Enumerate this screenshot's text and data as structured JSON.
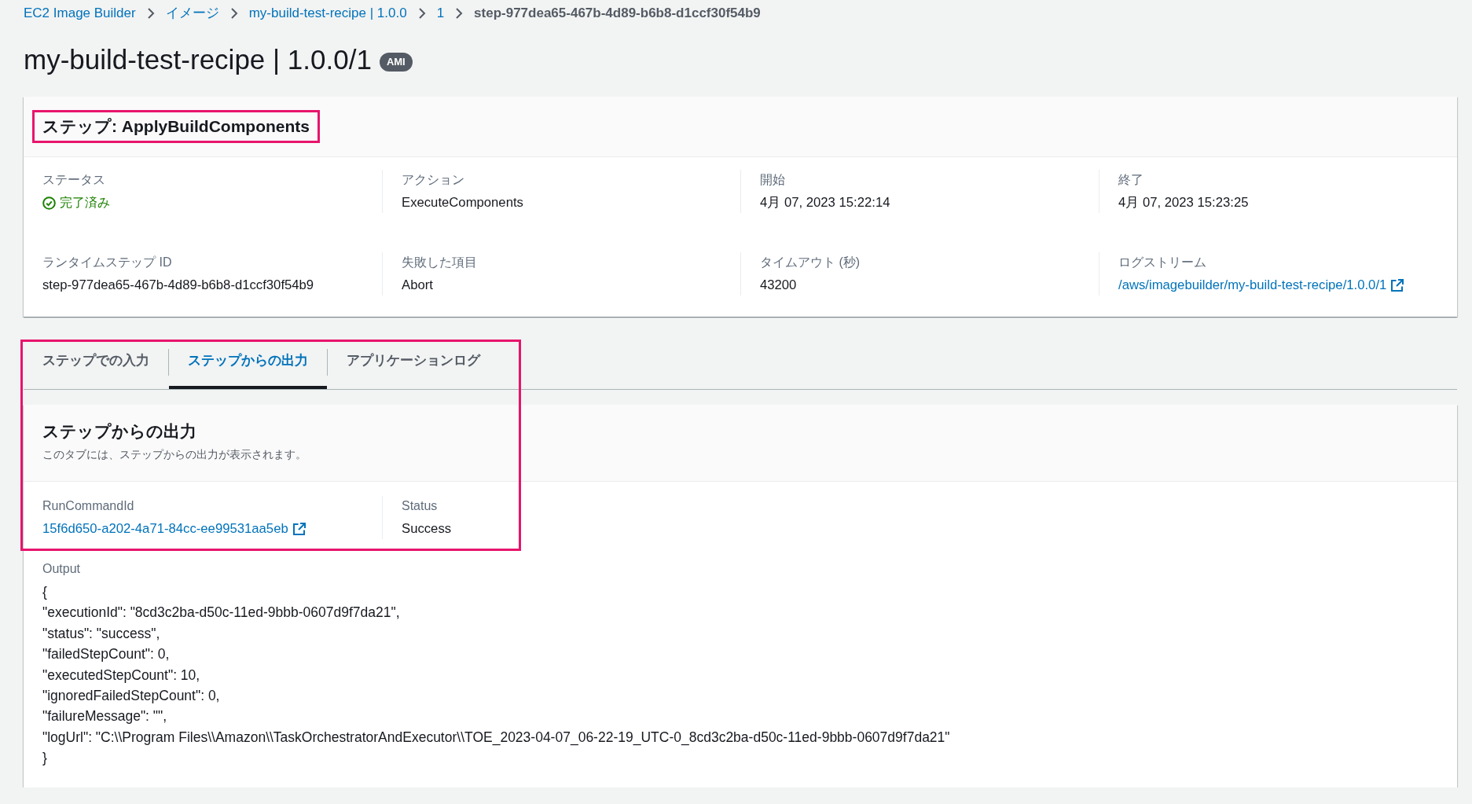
{
  "breadcrumbs": [
    {
      "label": "EC2 Image Builder",
      "current": false
    },
    {
      "label": "イメージ",
      "current": false
    },
    {
      "label": "my-build-test-recipe | 1.0.0",
      "current": false
    },
    {
      "label": "1",
      "current": false
    },
    {
      "label": "step-977dea65-467b-4d89-b6b8-d1ccf30f54b9",
      "current": true
    }
  ],
  "page_title": {
    "text": "my-build-test-recipe | 1.0.0/1",
    "badge": "AMI"
  },
  "step_card": {
    "title": "ステップ: ApplyBuildComponents",
    "highlighted": true,
    "fields": [
      {
        "label": "ステータス",
        "value": "完了済み",
        "kind": "status"
      },
      {
        "label": "アクション",
        "value": "ExecuteComponents",
        "kind": "text"
      },
      {
        "label": "開始",
        "value": "4月 07, 2023 15:22:14",
        "kind": "text"
      },
      {
        "label": "終了",
        "value": "4月 07, 2023 15:23:25",
        "kind": "text"
      },
      {
        "label": "ランタイムステップ ID",
        "value": "step-977dea65-467b-4d89-b6b8-d1ccf30f54b9",
        "kind": "text"
      },
      {
        "label": "失敗した項目",
        "value": "Abort",
        "kind": "text"
      },
      {
        "label": "タイムアウト (秒)",
        "value": "43200",
        "kind": "text"
      },
      {
        "label": "ログストリーム",
        "value": "/aws/imagebuilder/my-build-test-recipe/1.0.0/1",
        "kind": "external-link"
      }
    ]
  },
  "output_section": {
    "highlighted": true,
    "tabs": [
      {
        "label": "ステップでの入力",
        "selected": false
      },
      {
        "label": "ステップからの出力",
        "selected": true
      },
      {
        "label": "アプリケーションログ",
        "selected": false
      }
    ],
    "panel": {
      "title": "ステップからの出力",
      "description": "このタブには、ステップからの出力が表示されます。",
      "fields": [
        {
          "label": "RunCommandId",
          "value": "15f6d650-a202-4a71-84cc-ee99531aa5eb",
          "kind": "external-link"
        },
        {
          "label": "Status",
          "value": "Success",
          "kind": "text"
        }
      ],
      "output": {
        "label": "Output",
        "lines": [
          "{",
          "\"executionId\": \"8cd3c2ba-d50c-11ed-9bbb-0607d9f7da21\",",
          "\"status\": \"success\",",
          "\"failedStepCount\": 0,",
          "\"executedStepCount\": 10,",
          "\"ignoredFailedStepCount\": 0,",
          "\"failureMessage\": \"\",",
          "\"logUrl\": \"C:\\\\Program Files\\\\Amazon\\\\TaskOrchestratorAndExecutor\\\\TOE_2023-04-07_06-22-19_UTC-0_8cd3c2ba-d50c-11ed-9bbb-0607d9f7da21\"",
          "}"
        ]
      }
    }
  }
}
